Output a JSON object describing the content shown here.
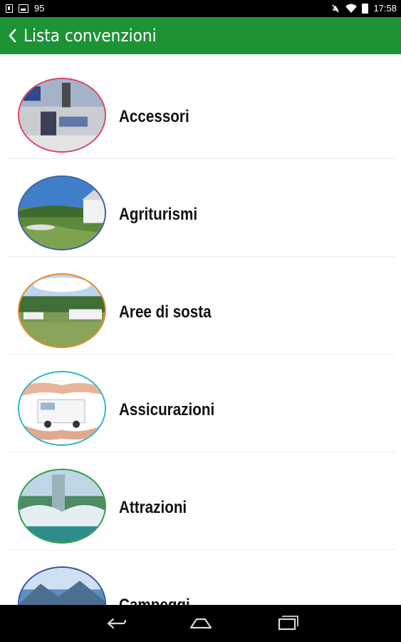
{
  "status_bar": {
    "notification_count": "95",
    "time": "17:58"
  },
  "app_bar": {
    "title": "Lista convenzioni",
    "back_icon": "chevron-left-icon"
  },
  "categories": [
    {
      "label": "Accessori",
      "ring_color": "#d8425e"
    },
    {
      "label": "Agriturismi",
      "ring_color": "#3a5fa8"
    },
    {
      "label": "Aree di sosta",
      "ring_color": "#e88a2a"
    },
    {
      "label": "Assicurazioni",
      "ring_color": "#2bb3c9"
    },
    {
      "label": "Attrazioni",
      "ring_color": "#2e9e4a"
    },
    {
      "label": "Campeggi",
      "ring_color": "#3a4fa8"
    }
  ],
  "navigation": {
    "back_icon": "back-icon",
    "home_icon": "home-icon",
    "recents_icon": "recents-icon"
  },
  "colors": {
    "app_bar": "#1c9436",
    "status_bar": "#000000",
    "nav_bar": "#000000"
  }
}
